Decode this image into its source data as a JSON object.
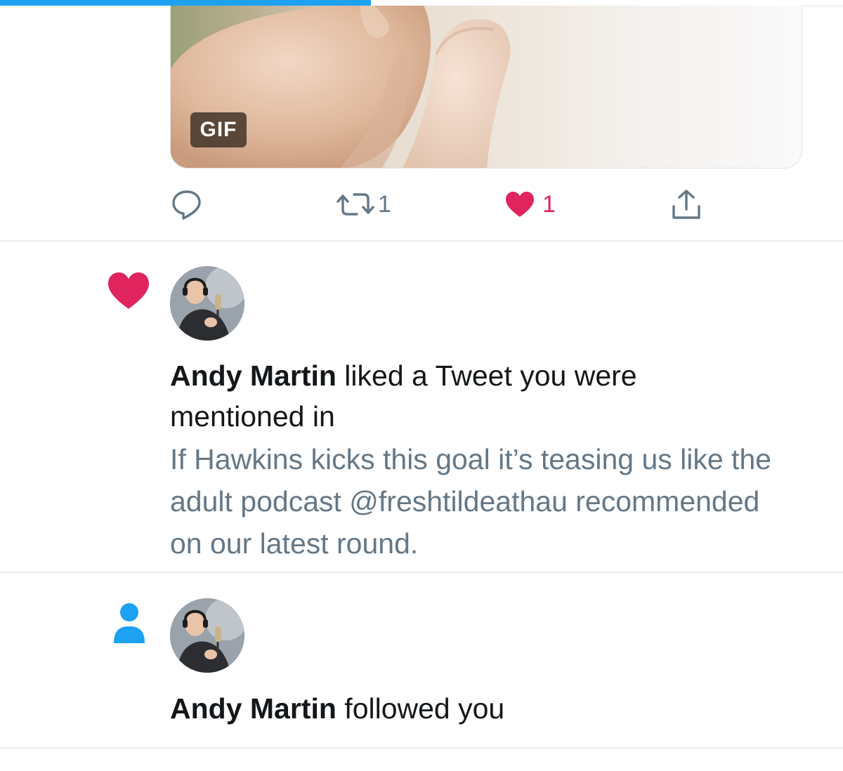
{
  "load_progress": 0.44,
  "media": {
    "badge": "GIF"
  },
  "tweet_actions": {
    "reply": {
      "icon": "reply-icon"
    },
    "retweet": {
      "icon": "retweet-icon",
      "count": "1"
    },
    "like": {
      "icon": "heart-icon",
      "count": "1",
      "active": true,
      "color": "#e0245e"
    },
    "share": {
      "icon": "share-icon"
    }
  },
  "notifications": [
    {
      "type": "like",
      "icon": "heart-icon",
      "icon_color": "#e0245e",
      "user": "Andy Martin",
      "action_text": " liked a Tweet you were mentioned in",
      "tweet_text": "If Hawkins kicks this goal it’s teasing us like the adult podcast @freshtildeathau recommended on our latest round."
    },
    {
      "type": "follow",
      "icon": "person-icon",
      "icon_color": "#1da1f2",
      "user": "Andy Martin",
      "action_text": " followed you"
    }
  ],
  "colors": {
    "accent": "#1da1f2",
    "like": "#e0245e",
    "secondary_text": "#657786",
    "divider": "#e6ecf0"
  }
}
